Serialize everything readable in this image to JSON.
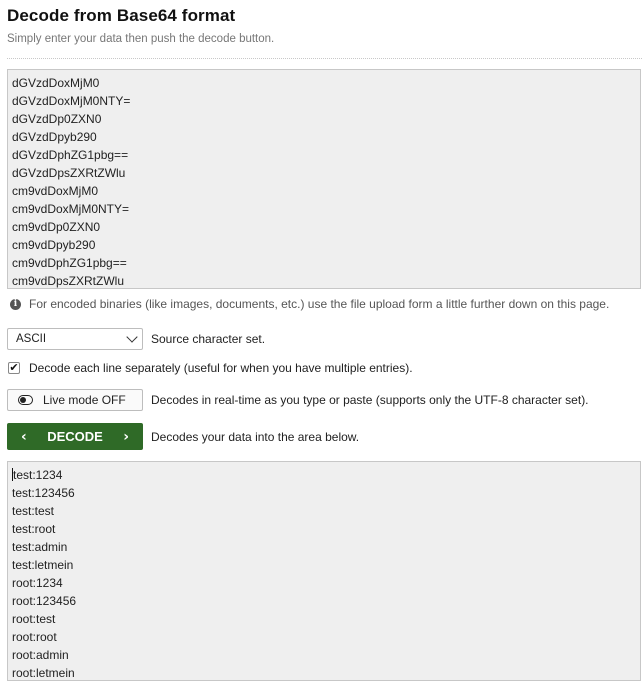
{
  "header": {
    "title": "Decode from Base64 format",
    "subtitle": "Simply enter your data then push the decode button."
  },
  "input": {
    "lines": [
      "dGVzdDoxMjM0",
      "dGVzdDoxMjM0NTY=",
      "dGVzdDp0ZXN0",
      "dGVzdDpyb290",
      "dGVzdDphZG1pbg==",
      "dGVzdDpsZXRtZWlu",
      "cm9vdDoxMjM0",
      "cm9vdDoxMjM0NTY=",
      "cm9vdDp0ZXN0",
      "cm9vdDpyb290",
      "cm9vdDphZG1pbg==",
      "cm9vdDpsZXRtZWlu"
    ]
  },
  "info": {
    "text": "For encoded binaries (like images, documents, etc.) use the file upload form a little further down on this page."
  },
  "charset": {
    "value": "ASCII",
    "label": "Source character set."
  },
  "each_line": {
    "checked": true,
    "label": "Decode each line separately (useful for when you have multiple entries)."
  },
  "live_mode": {
    "button": "Live mode OFF",
    "label": "Decodes in real-time as you type or paste (supports only the UTF-8 character set)."
  },
  "decode": {
    "button": "DECODE",
    "label": "Decodes your data into the area below."
  },
  "output": {
    "lines": [
      "test:1234",
      "test:123456",
      "test:test",
      "test:root",
      "test:admin",
      "test:letmein",
      "root:1234",
      "root:123456",
      "root:test",
      "root:root",
      "root:admin",
      "root:letmein"
    ]
  }
}
